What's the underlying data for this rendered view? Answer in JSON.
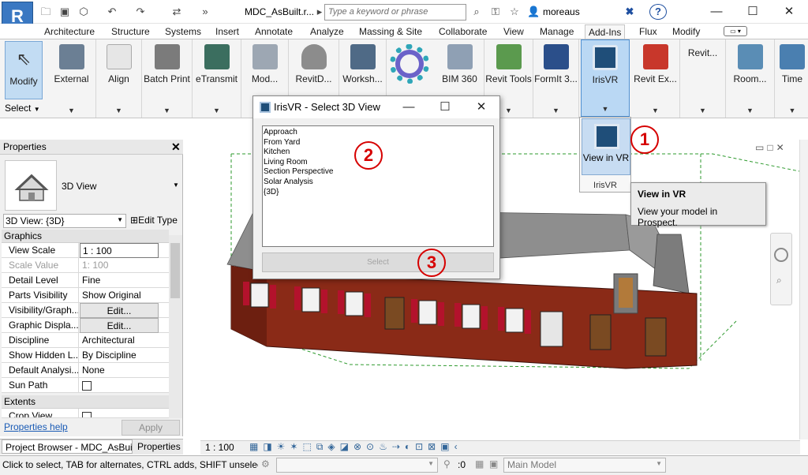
{
  "title_bar": {
    "app_letter": "R",
    "document_title": "MDC_AsBuilt.r...",
    "search_placeholder": "Type a keyword or phrase",
    "user_name": "moreaus",
    "help_label": "?",
    "minimize": "—",
    "maximize": "☐",
    "close": "✕"
  },
  "ribbon_tabs": [
    "Architecture",
    "Structure",
    "Systems",
    "Insert",
    "Annotate",
    "Analyze",
    "Massing & Site",
    "Collaborate",
    "View",
    "Manage",
    "Add-Ins",
    "Flux",
    "Modify"
  ],
  "active_tab": "Add-Ins",
  "ribbon_buttons": {
    "modify": "Modify",
    "select": "Select",
    "external": "External",
    "align": "Align",
    "batch_print": "Batch Print",
    "etransmit": "eTransmit",
    "model_review": "Mod...",
    "revit_db": "RevitD...",
    "worksharing": "Worksh...",
    "bim360": "BIM 360",
    "revit_tools": "Revit Tools",
    "formit": "FormIt 3...",
    "irisvr": "IrisVR",
    "revit_extensions": "Revit Ex...",
    "revit_more": "Revit...",
    "room": "Room...",
    "time": "Time"
  },
  "irisvr_dropdown": {
    "item_label": "View in VR",
    "panel_label": "IrisVR"
  },
  "tooltip": {
    "title": "View in VR",
    "description": "View your model in Prospect."
  },
  "callouts": [
    "1",
    "2",
    "3"
  ],
  "properties": {
    "header": "Properties",
    "close": "✕",
    "type_name": "3D View",
    "instance_selector": "3D View: {3D}",
    "edit_type": "Edit Type",
    "sections": {
      "graphics": "Graphics",
      "extents": "Extents"
    },
    "rows": [
      {
        "name": "View Scale",
        "value": "1 : 100"
      },
      {
        "name": "Scale Value",
        "value": "1:  100"
      },
      {
        "name": "Detail Level",
        "value": "Fine"
      },
      {
        "name": "Parts Visibility",
        "value": "Show Original"
      },
      {
        "name": "Visibility/Graph...",
        "value": "Edit..."
      },
      {
        "name": "Graphic Displa...",
        "value": "Edit..."
      },
      {
        "name": "Discipline",
        "value": "Architectural"
      },
      {
        "name": "Show Hidden L...",
        "value": "By Discipline"
      },
      {
        "name": "Default Analysi...",
        "value": "None"
      },
      {
        "name": "Sun Path",
        "value": ""
      },
      {
        "name": "Crop View",
        "value": ""
      }
    ],
    "help_link": "Properties help",
    "apply_button": "Apply"
  },
  "bottom_tabs": [
    "Project Browser - MDC_AsBuil...",
    "Properties"
  ],
  "view_scale_display": "1 : 100",
  "dialog": {
    "title": "IrisVR - Select 3D View",
    "views": [
      "Approach",
      "From Yard",
      "Kitchen",
      "Living Room",
      "Section Perspective",
      "Solar Analysis",
      "{3D}"
    ],
    "select_button": "Select"
  },
  "status_bar": {
    "hint": "Click to select, TAB for alternates, CTRL adds, SHIFT unselects.",
    "filter_count": ":0",
    "design_option": "Main Model"
  },
  "colors": {
    "brick": "#8a2a17",
    "roof": "#8e8e8e",
    "shutters": "#b3122c",
    "accent_blue": "#3a78c2",
    "callout_red": "#d60000"
  }
}
